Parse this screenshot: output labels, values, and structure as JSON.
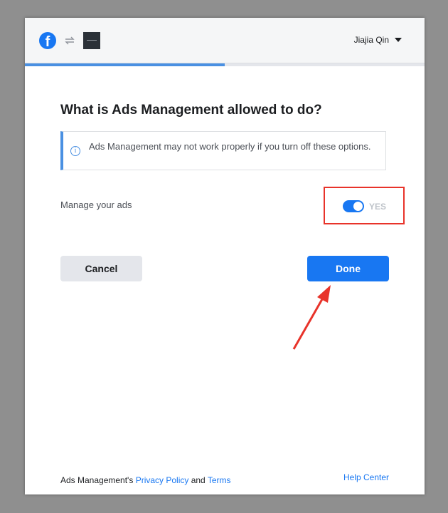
{
  "header": {
    "fb_logo_icon": "facebook-logo",
    "swap_icon": "swap-arrows-icon",
    "app_thumbnail_icon": "app-thumbnail",
    "user_name": "Jiajia Qin",
    "caret_icon": "caret-down-icon"
  },
  "progress": {
    "fraction": 0.5,
    "color": "#4a90e2"
  },
  "main": {
    "title": "What is Ads Management allowed to do?",
    "notice_text": "Ads Management may not work properly if you turn off these options.",
    "notice_icon": "info-icon",
    "permission": {
      "label": "Manage your ads",
      "enabled": true,
      "state_text": "YES"
    }
  },
  "actions": {
    "cancel_label": "Cancel",
    "done_label": "Done",
    "primary_color": "#1877f2"
  },
  "annotation": {
    "highlight_color": "#e8332a",
    "arrow_color": "#e8332a"
  },
  "footer": {
    "prefix": "Ads Management's ",
    "privacy_label": "Privacy Policy",
    "and_text": " and ",
    "terms_label": "Terms",
    "help_label": "Help Center"
  }
}
